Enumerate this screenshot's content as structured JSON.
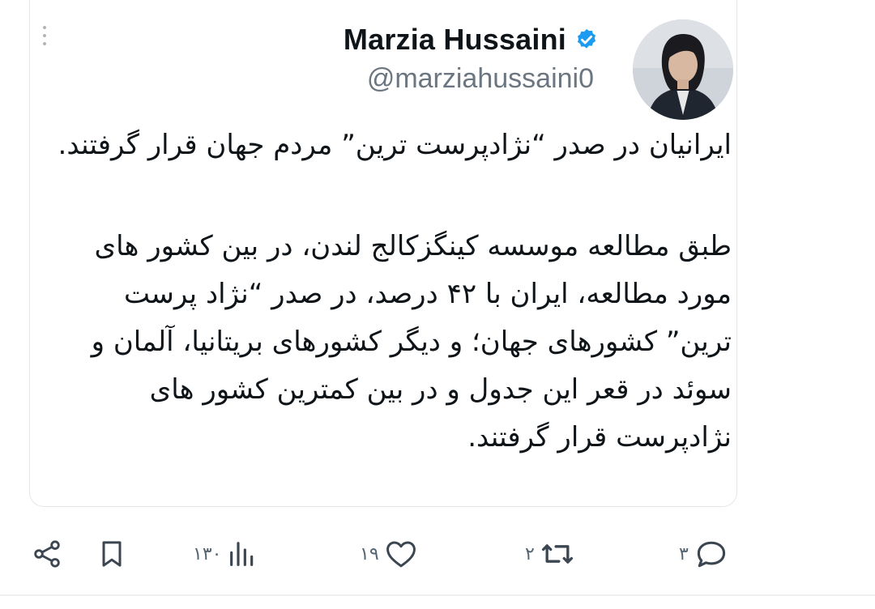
{
  "tweet": {
    "display_name": "Marzia Hussaini",
    "handle": "@marziahussaini0",
    "verified": true,
    "paragraph1": "ایرانیان در صدر “نژادپرست ترین” مردم جهان قرار گرفتند.",
    "paragraph2": "طبق مطالعه موسسه کینگزکالج لندن، در بین کشور های مورد مطالعه، ایران با ۴۲ درصد، در صدر “نژاد پرست ترین” کشورهای جهان؛ و دیگر کشورهای بریتانیا، آلمان و سوئد در قعر این جدول و در بین کمترین کشور های نژادپرست قرار گرفتند."
  },
  "actions": {
    "share_icon": "share-icon",
    "bookmark_icon": "bookmark-icon",
    "views_count": "۱۳۰",
    "likes_count": "۱۹",
    "retweets_count": "۲",
    "replies_count": "۳"
  },
  "colors": {
    "text": "#0f1419",
    "muted": "#536471",
    "verified": "#1d9bf0"
  }
}
